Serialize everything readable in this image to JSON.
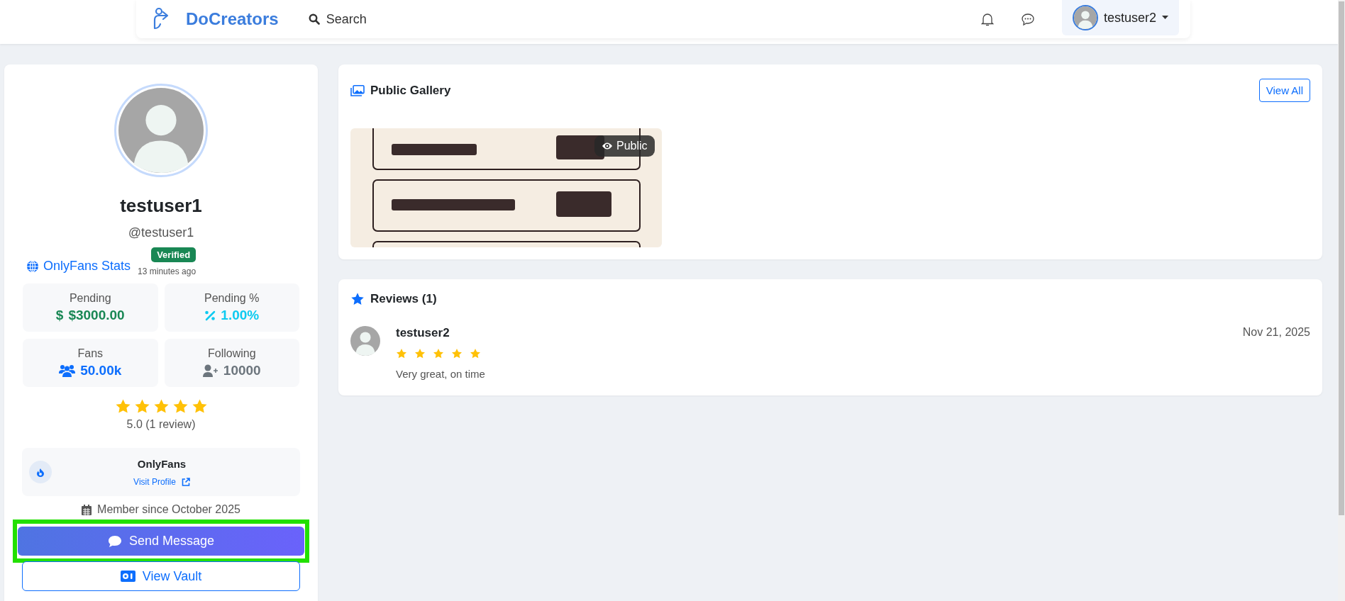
{
  "header": {
    "brand": "DoCreators",
    "search": "Search",
    "user": "testuser2"
  },
  "profile": {
    "name": "testuser1",
    "handle": "@testuser1",
    "stats_link": "OnlyFans Stats",
    "verified_badge": "Verified",
    "verified_time": "13 minutes ago",
    "stats": [
      {
        "kind": "money",
        "label": "Pending",
        "icon_text": "$",
        "value": "$3000.00",
        "color": "#198754"
      },
      {
        "kind": "percent",
        "label": "Pending %",
        "value": "1.00%",
        "color": "#0dcaf0"
      },
      {
        "kind": "fans",
        "label": "Fans",
        "value": "50.00k",
        "color": "#0d6efd"
      },
      {
        "kind": "following",
        "label": "Following",
        "value": "10000",
        "color": "#6c757d"
      }
    ],
    "stars": 5,
    "rating": "5.0 (1 review)",
    "platform": {
      "name": "OnlyFans",
      "link": "Visit Profile"
    },
    "member_since": "Member since October 2025",
    "buttons": [
      {
        "kind": "primary",
        "label": "Send Message",
        "highlighted": true
      },
      {
        "kind": "outline",
        "label": "View Vault",
        "highlighted": false
      }
    ]
  },
  "gallery": {
    "title": "Public Gallery",
    "view_all": "View All",
    "items": [
      {
        "kind": "picture",
        "badge": "Public"
      }
    ]
  },
  "reviews": {
    "title": "Reviews (1)",
    "items": [
      {
        "author": "testuser2",
        "stars": 5,
        "date": "Nov 21, 2025",
        "text": "Very great, on time"
      }
    ]
  }
}
